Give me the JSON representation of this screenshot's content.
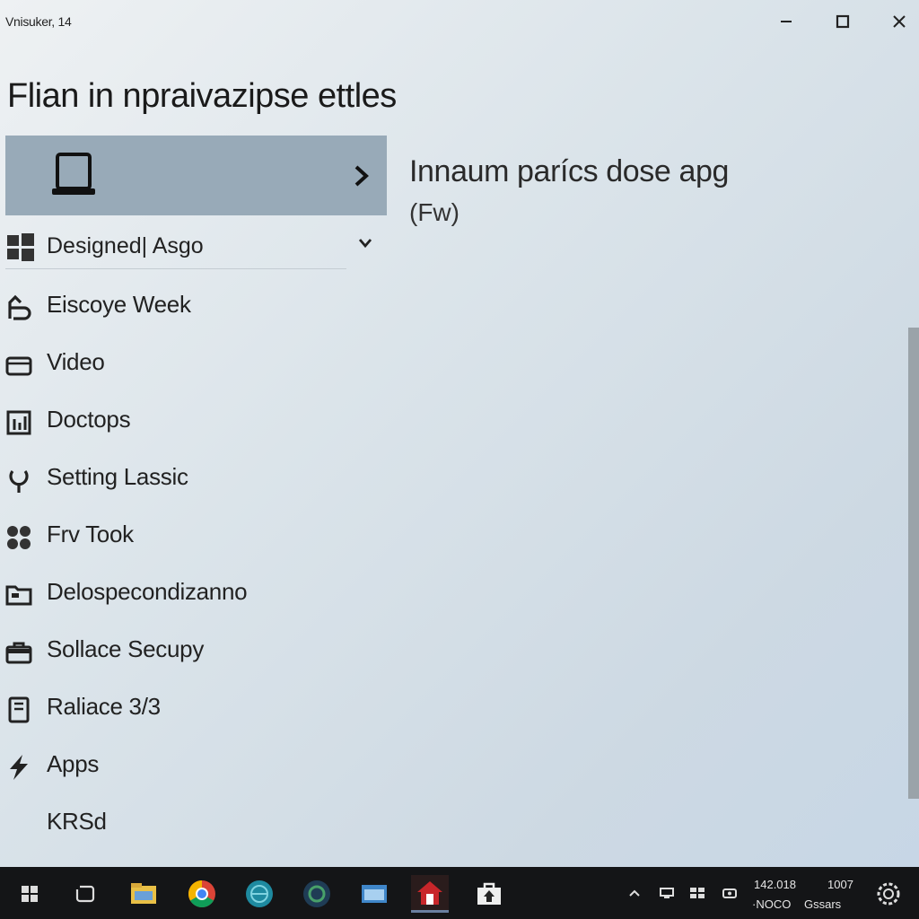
{
  "window": {
    "title": "Vnisuker, 14"
  },
  "page": {
    "title": "Flian in npraivazipse ettles"
  },
  "device_card": {
    "detail_title": "Innaum parícs dose apg",
    "detail_sub": "(Fw)"
  },
  "dropdown": {
    "label": "Designed| Asgo"
  },
  "nav": {
    "items": [
      {
        "label": "Eiscoye Week",
        "icon": "recent-icon"
      },
      {
        "label": "Video",
        "icon": "video-icon"
      },
      {
        "label": "Doctops",
        "icon": "chart-icon"
      },
      {
        "label": "Setting Lassic",
        "icon": "location-icon"
      },
      {
        "label": "Frv Took",
        "icon": "apps-grid-icon"
      },
      {
        "label": "Delospecondizanno",
        "icon": "folder-icon"
      },
      {
        "label": "Sollace Secupy",
        "icon": "briefcase-icon"
      },
      {
        "label": "Raliace 3/3",
        "icon": "document-icon"
      },
      {
        "label": "Apps",
        "icon": "bolt-icon"
      },
      {
        "label": "KRSd",
        "icon": ""
      }
    ]
  },
  "taskbar": {
    "clock": {
      "line1_left": "142.018",
      "line1_right": "1007",
      "line2_left": "·NOCO",
      "line2_right": "Gssars"
    }
  },
  "colors": {
    "card_bg": "#98aab8",
    "taskbar_bg": "#141517",
    "scrollbar": "#9aa3a9"
  }
}
